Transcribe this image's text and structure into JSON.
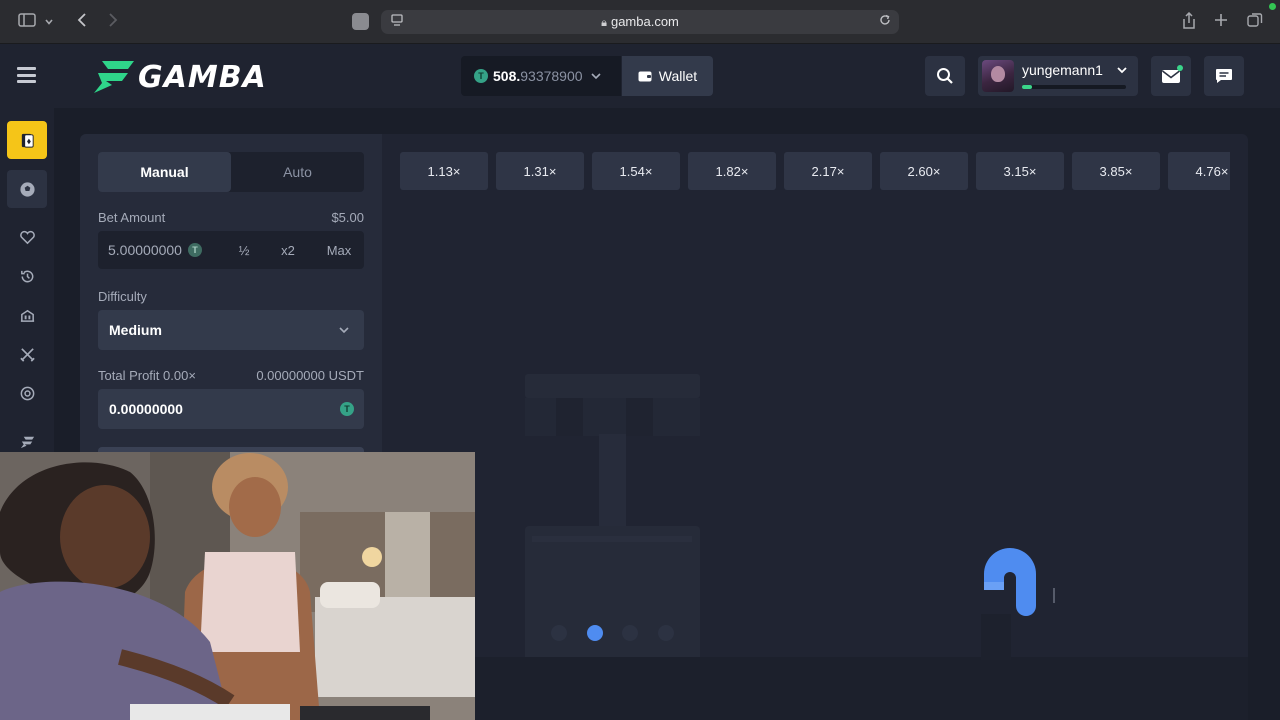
{
  "browser": {
    "url": "gamba.com",
    "tab_badge": "tabs"
  },
  "header": {
    "logo_text": "GAMBA",
    "balance_int": "508.",
    "balance_dec": "93378900",
    "wallet_label": "Wallet",
    "username": "yungemann1",
    "xp_progress": 0.1
  },
  "sidebar": {
    "tabs": [
      "Manual",
      "Auto"
    ],
    "bet_label": "Bet Amount",
    "bet_usd": "$5.00",
    "bet_value": "5.00000000",
    "half_label": "½",
    "double_label": "x2",
    "max_label": "Max",
    "difficulty_label": "Difficulty",
    "difficulty_value": "Medium",
    "profit_label": "Total Profit 0.00×",
    "profit_amount": "0.00000000 USDT",
    "profit_value": "0.00000000"
  },
  "multipliers": [
    "1.13×",
    "1.31×",
    "1.54×",
    "1.82×",
    "2.17×",
    "2.60×",
    "3.15×",
    "3.85×",
    "4.76×"
  ],
  "game": {
    "stage_count": 4,
    "active_stage": 1
  },
  "colors": {
    "accent_green": "#3ad58a",
    "coin_green": "#35a287",
    "active_rail": "#f5c518",
    "stage_blue": "#4f8cf0"
  }
}
